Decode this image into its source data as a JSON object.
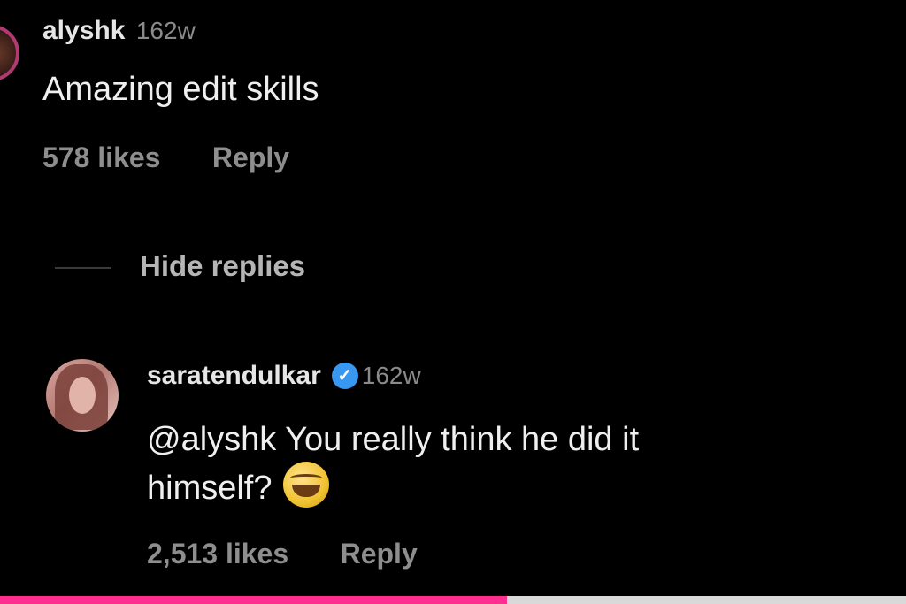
{
  "comments": [
    {
      "username": "alyshk",
      "time": "162w",
      "text": "Amazing edit skills",
      "likes": "578 likes",
      "reply_label": "Reply"
    }
  ],
  "thread": {
    "hide_replies_label": "Hide replies"
  },
  "replies": [
    {
      "username": "saratendulkar",
      "verified_icon": "verified-badge-icon",
      "verified_mark": "✓",
      "time": "162w",
      "text_line1": "@alyshk You really think he did it",
      "text_line2": "himself?",
      "emoji_icon": "laughing-emoji-icon",
      "likes": "2,513 likes",
      "reply_label": "Reply"
    }
  ],
  "progress": {
    "fraction": 0.56,
    "color": "#ff2e8f"
  }
}
